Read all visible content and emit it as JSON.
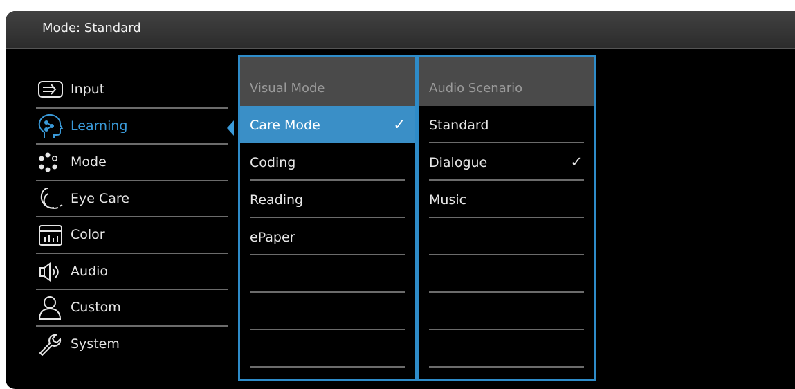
{
  "header": {
    "title": "Mode: Standard"
  },
  "main_menu": {
    "items": [
      {
        "label": "Input",
        "icon": "input-icon"
      },
      {
        "label": "Learning",
        "icon": "learning-icon",
        "active": true
      },
      {
        "label": "Mode",
        "icon": "mode-icon"
      },
      {
        "label": "Eye Care",
        "icon": "eye-care-icon"
      },
      {
        "label": "Color",
        "icon": "color-icon"
      },
      {
        "label": "Audio",
        "icon": "audio-icon"
      },
      {
        "label": "Custom",
        "icon": "custom-icon"
      },
      {
        "label": "System",
        "icon": "system-icon"
      }
    ]
  },
  "visual_mode": {
    "title": "Visual Mode",
    "items": [
      {
        "label": "Care Mode",
        "checked": true,
        "selected": true
      },
      {
        "label": "Coding"
      },
      {
        "label": "Reading"
      },
      {
        "label": "ePaper"
      },
      {
        "label": ""
      },
      {
        "label": ""
      },
      {
        "label": ""
      }
    ]
  },
  "audio_scenario": {
    "title": "Audio Scenario",
    "items": [
      {
        "label": "Standard"
      },
      {
        "label": "Dialogue",
        "checked": true
      },
      {
        "label": "Music"
      },
      {
        "label": ""
      },
      {
        "label": ""
      },
      {
        "label": ""
      },
      {
        "label": ""
      }
    ]
  },
  "check_glyph": "✓",
  "colors": {
    "accent": "#3a9ad9",
    "panel_border": "#2e8bc8",
    "background": "#000000"
  }
}
